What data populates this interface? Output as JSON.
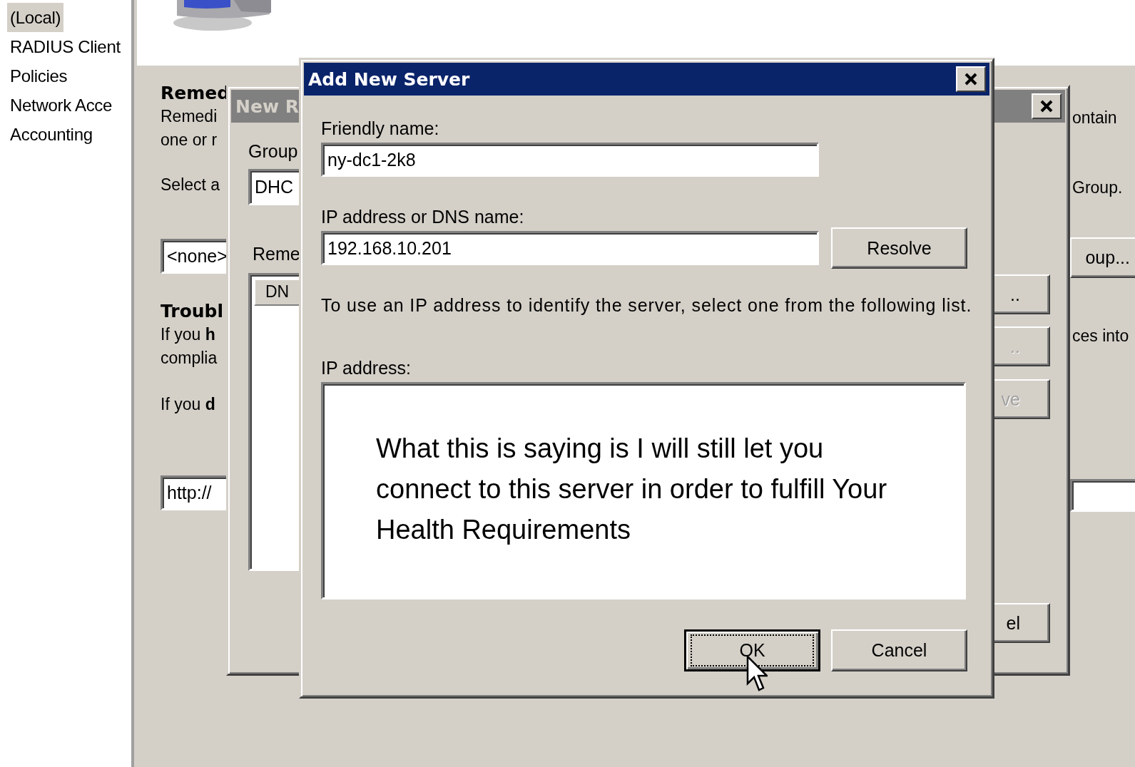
{
  "navigation_tree": {
    "items": [
      {
        "label": "(Local)",
        "selected": true
      },
      {
        "label": "RADIUS Client",
        "selected": false
      },
      {
        "label": "Policies",
        "selected": false
      },
      {
        "label": "Network Acce",
        "selected": false
      },
      {
        "label": "Accounting",
        "selected": false
      }
    ]
  },
  "background_page": {
    "left_column": [
      {
        "kind": "heading",
        "text": "Remed"
      },
      {
        "kind": "text",
        "text": "Remedi"
      },
      {
        "kind": "text",
        "text": "one or r"
      },
      {
        "kind": "text",
        "text": "Select a"
      },
      {
        "kind": "field",
        "text": "<none>"
      },
      {
        "kind": "heading",
        "text": "Troubl"
      },
      {
        "kind": "text",
        "text": "If you **h**"
      },
      {
        "kind": "text",
        "text": "complia"
      },
      {
        "kind": "text",
        "text": "If you **d**"
      },
      {
        "kind": "field",
        "text": "http://"
      }
    ],
    "right_column": [
      {
        "kind": "text",
        "text": "ontain"
      },
      {
        "kind": "text",
        "text": "Group."
      },
      {
        "kind": "button",
        "text": "oup..."
      },
      {
        "kind": "text",
        "text": "ces into"
      },
      {
        "kind": "field"
      }
    ]
  },
  "new_dialog": {
    "title": "New R",
    "active": false,
    "group_label": "Group",
    "group_value": "DHC",
    "list_label": "Reme",
    "list_header": "DN",
    "buttons": [
      {
        "label": "..",
        "disabled": false
      },
      {
        "label": "..",
        "disabled": true
      },
      {
        "label": "ve",
        "disabled": true
      },
      {
        "label": "el",
        "disabled": false
      }
    ]
  },
  "add_server_dialog": {
    "title": "Add New Server",
    "active": true,
    "friendly_name_label": "Friendly name:",
    "friendly_name_value": "ny-dc1-2k8",
    "address_label": "IP address or DNS name:",
    "address_value": "192.168.10.201",
    "resolve_button": "Resolve",
    "hint": "To use an IP address to identify the server, select one from the following list.",
    "ip_list_label": "IP address:",
    "annotation": "What this is saying is I will still let you connect to this server in order to fulfill Your Health Requirements",
    "buttons": [
      {
        "label": "OK",
        "default": true
      },
      {
        "label": "Cancel",
        "default": false
      }
    ]
  }
}
